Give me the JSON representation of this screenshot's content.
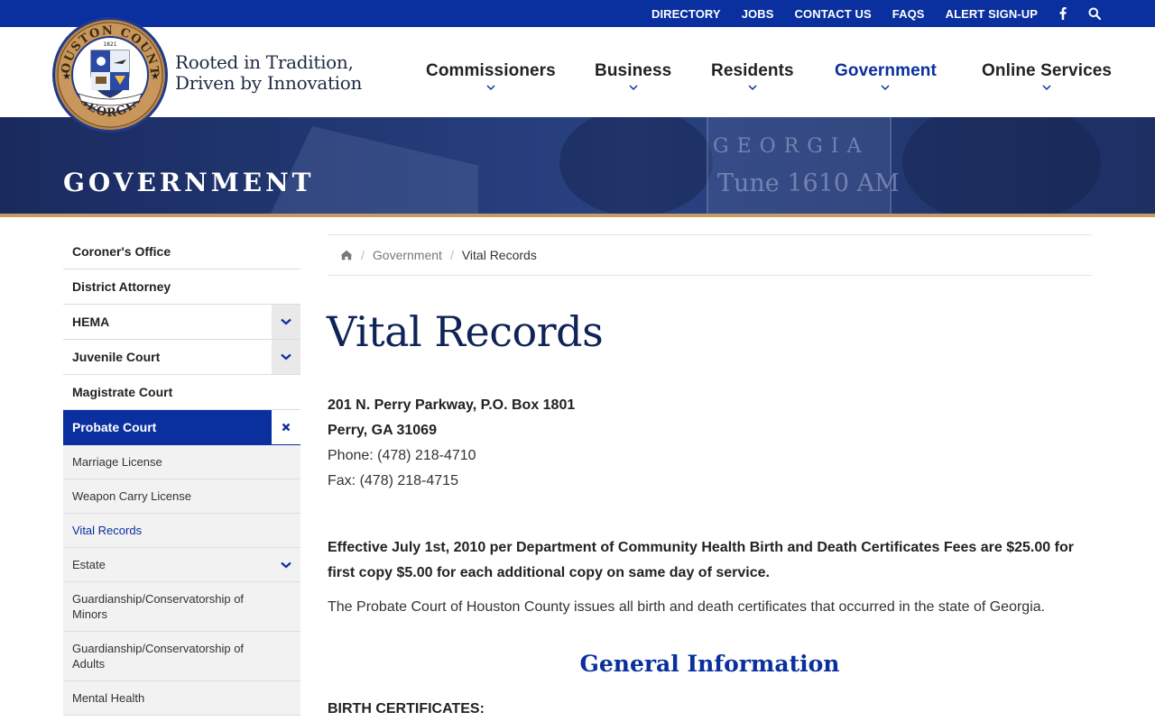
{
  "utility_nav": {
    "links": [
      "DIRECTORY",
      "JOBS",
      "CONTACT US",
      "FAQS",
      "ALERT SIGN-UP"
    ],
    "icons": [
      "facebook-icon",
      "search-icon"
    ]
  },
  "brand": {
    "seal_text_top": "HOUSTON COUNTY",
    "seal_text_bottom": "GEORGIA",
    "seal_year": "1821",
    "tagline_line1": "Rooted in Tradition,",
    "tagline_line2": "Driven by Innovation",
    "colors": {
      "primary": "#0a2f9e",
      "navy": "#0f2456",
      "gold": "#c89b63"
    }
  },
  "main_nav": [
    {
      "label": "Commissioners"
    },
    {
      "label": "Business"
    },
    {
      "label": "Residents"
    },
    {
      "label": "Government",
      "active": true
    },
    {
      "label": "Online Services"
    }
  ],
  "hero": {
    "title": "GOVERNMENT",
    "sign_line1": "GEORGIA",
    "sign_line2": "Tune 1610 AM"
  },
  "sidebar": {
    "items": [
      {
        "label": "Coroner's Office"
      },
      {
        "label": "District Attorney"
      },
      {
        "label": "HEMA",
        "expandable": true
      },
      {
        "label": "Juvenile Court",
        "expandable": true
      },
      {
        "label": "Magistrate Court"
      },
      {
        "label": "Probate Court",
        "active": true,
        "expanded": true
      }
    ],
    "sub_items": [
      {
        "label": "Marriage License"
      },
      {
        "label": "Weapon Carry License"
      },
      {
        "label": "Vital Records",
        "current": true
      },
      {
        "label": "Estate",
        "expandable": true
      },
      {
        "label": "Guardianship/Conservatorship of Minors"
      },
      {
        "label": "Guardianship/Conservatorship of Adults"
      },
      {
        "label": "Mental Health"
      }
    ]
  },
  "breadcrumb": {
    "items": [
      "Government",
      "Vital Records"
    ]
  },
  "main": {
    "title": "Vital Records",
    "address_line1": "201 N. Perry Parkway, P.O. Box 1801",
    "address_line2": "Perry, GA 31069",
    "phone": "Phone: (478) 218-4710",
    "fax": "Fax: (478) 218-4715",
    "fees_notice": "Effective July 1st, 2010 per Department of Community Health Birth and Death Certificates Fees are $25.00 for first copy $5.00 for each additional copy on same day of service.",
    "intro": "The Probate Court of Houston County issues all birth and death certificates that occurred in the state of Georgia.",
    "section_title": "General Information",
    "sub_heading": "BIRTH CERTIFICATES:"
  }
}
